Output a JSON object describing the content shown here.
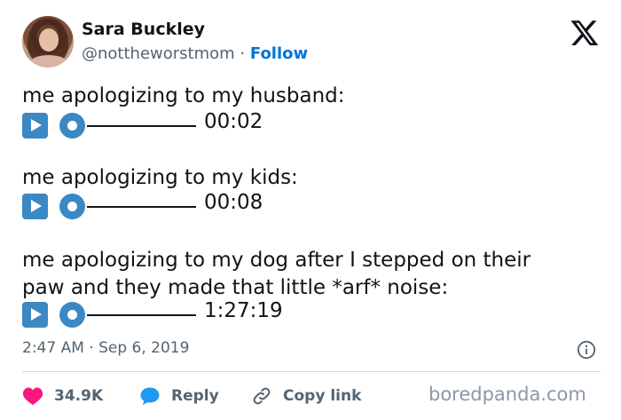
{
  "author": {
    "name": "Sara Buckley",
    "handle": "@nottheworstmom",
    "separator": "·",
    "follow_label": "Follow"
  },
  "tweet": {
    "line1": "me apologizing to my husband:",
    "time1": "00:02",
    "line2": "me apologizing to my kids:",
    "time2": "00:08",
    "line3a": "me apologizing to my dog after I stepped on their",
    "line3b": "paw and they made that little *arf* noise:",
    "time3": "1:27:19"
  },
  "meta": {
    "timestamp": "2:47 AM · Sep 6, 2019"
  },
  "actions": {
    "likes_count": "34.9K",
    "reply_label": "Reply",
    "copy_label": "Copy link"
  },
  "watermark": "boredpanda.com",
  "colors": {
    "accent_blue": "#0074d6",
    "media_blue": "#3b88c3",
    "heart_red": "#f91880",
    "muted_text": "#536471"
  },
  "icons": [
    "x-logo-icon",
    "play-button-icon",
    "record-button-icon",
    "info-icon",
    "heart-icon",
    "reply-bubble-icon",
    "link-icon"
  ]
}
